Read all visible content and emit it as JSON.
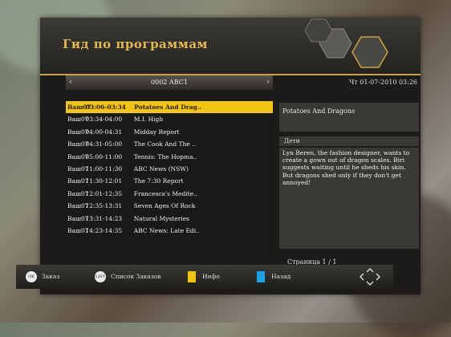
{
  "header": {
    "title": "Гид по программам"
  },
  "channel_bar": {
    "prev_arrow": "‹",
    "channel": "0002 ABC1",
    "next_arrow": "›"
  },
  "datetime": "Чт 01-07-2010 03:26",
  "program_list": [
    {
      "day": "Ваш07",
      "time": "03:06-03:34",
      "title": "Potatoes And Drag..",
      "selected": true
    },
    {
      "day": "Ваш07",
      "time": "03:34-04:00",
      "title": "M.I. High"
    },
    {
      "day": "Ваш07",
      "time": "04:00-04:31",
      "title": "Midday Report"
    },
    {
      "day": "Ваш07",
      "time": "04:31-05:00",
      "title": "The Cook And The .."
    },
    {
      "day": "Ваш07",
      "time": "05:00-11:00",
      "title": "Tennis: The Hopma.."
    },
    {
      "day": "Ваш07",
      "time": "11:00-11:30",
      "title": "ABC News (NSW)"
    },
    {
      "day": "Ваш07",
      "time": "11:30-12:01",
      "title": "The 7:30 Report"
    },
    {
      "day": "Ваш07",
      "time": "12:01-12:35",
      "title": "Francesca's Medite.."
    },
    {
      "day": "Ваш07",
      "time": "12:35-13:31",
      "title": "Seven Ages Of Rock"
    },
    {
      "day": "Ваш07",
      "time": "13:31-14:23",
      "title": "Natural Mysteries"
    },
    {
      "day": "Ваш07",
      "time": "14:23-14:35",
      "title": "ABC News: Late Edi.."
    }
  ],
  "detail": {
    "program_title": "Potatoes And Dragons",
    "genre": "Дети",
    "description": "Lyn Beren, the fashion designer, wants to create a gown out of dragon scales. Biri suggests waiting until he sheds his skin. But dragons shed only if they don't get annoyed!",
    "page": "Страница  1 / 1"
  },
  "footer": {
    "ok_icon_text": "OK",
    "ok_label": "Заказ",
    "list_icon_text": "LIST",
    "list_label": "Список Заказов",
    "yellow_label": "Инфо",
    "blue_label": "Назад"
  },
  "colors": {
    "accent": "#e2b94d",
    "selected_row": "#f1c40f",
    "yellow_key": "#f5c400",
    "blue_key": "#1aa3e8"
  }
}
